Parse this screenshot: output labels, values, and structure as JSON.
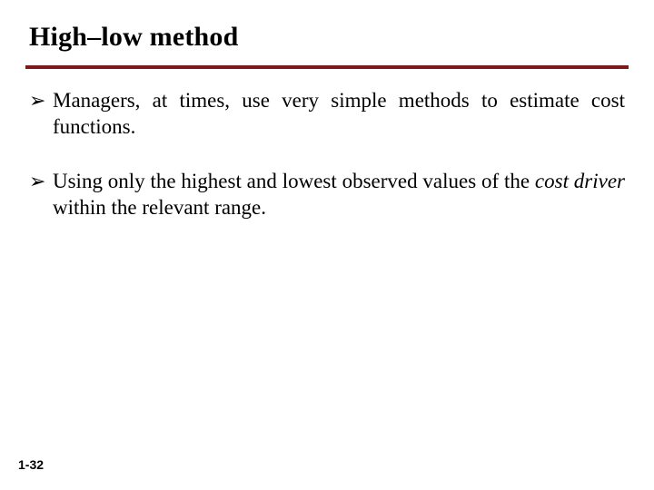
{
  "title": "High–low method",
  "bullets": [
    {
      "marker": "➢",
      "text": "Managers, at times, use very simple methods to estimate cost functions."
    },
    {
      "marker": "➢",
      "text_before": "Using only the highest and lowest observed values of the ",
      "italic": "cost driver",
      "text_after": " within the relevant range."
    }
  ],
  "page_number": "1-32"
}
